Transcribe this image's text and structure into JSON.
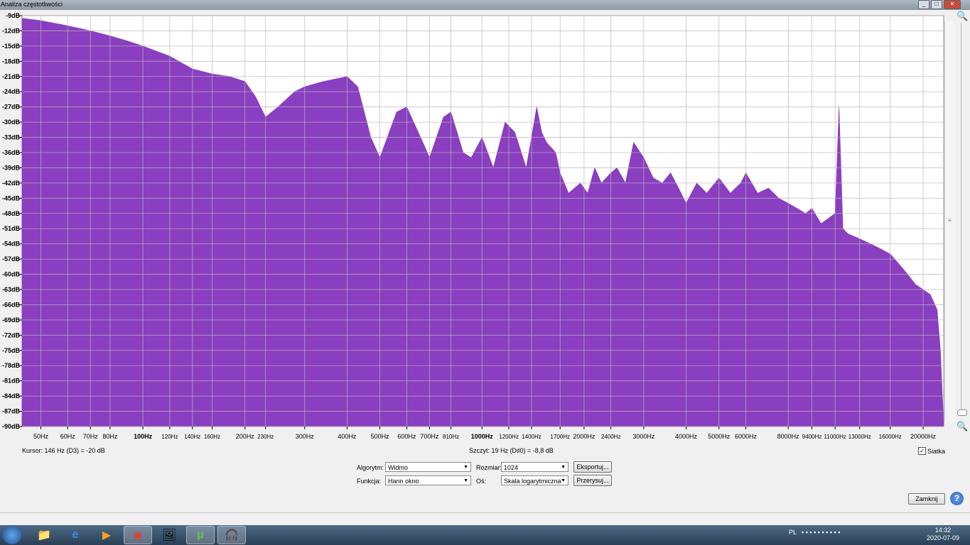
{
  "window": {
    "title": "Analiza częstotliwości",
    "controls": [
      "minimize-icon",
      "maximize-icon",
      "close-icon"
    ]
  },
  "chart_data": {
    "type": "area",
    "xscale": "log",
    "xlim": [
      44,
      23000
    ],
    "ylim": [
      -90,
      -9
    ],
    "grid": true,
    "fill_color": "#8a3ec0",
    "y_ticks": [
      -9,
      -12,
      -15,
      -18,
      -21,
      -24,
      -27,
      -30,
      -33,
      -36,
      -39,
      -42,
      -45,
      -48,
      -51,
      -54,
      -57,
      -60,
      -63,
      -66,
      -69,
      -72,
      -75,
      -78,
      -81,
      -84,
      -87,
      -90
    ],
    "y_tick_labels": [
      "-9dB",
      "-12dB",
      "-15dB",
      "-18dB",
      "-21dB",
      "-24dB",
      "-27dB",
      "-30dB",
      "-33dB",
      "-36dB",
      "-39dB",
      "-42dB",
      "-45dB",
      "-48dB",
      "-51dB",
      "-54dB",
      "-57dB",
      "-60dB",
      "-63dB",
      "-66dB",
      "-69dB",
      "-72dB",
      "-75dB",
      "-78dB",
      "-81dB",
      "-84dB",
      "-87dB",
      "-90dB"
    ],
    "x_ticks": [
      50,
      60,
      70,
      80,
      100,
      120,
      140,
      160,
      200,
      230,
      300,
      400,
      500,
      600,
      700,
      810,
      1000,
      1200,
      1400,
      1700,
      2000,
      2400,
      3000,
      4000,
      5000,
      6000,
      8000,
      9400,
      11000,
      13000,
      16000,
      20000
    ],
    "x_tick_labels": [
      "50Hz",
      "60Hz",
      "70Hz",
      "80Hz",
      "100Hz",
      "120Hz",
      "140Hz",
      "160Hz",
      "200Hz",
      "230Hz",
      "300Hz",
      "400Hz",
      "500Hz",
      "600Hz",
      "700Hz",
      "810Hz",
      "1000Hz",
      "1200Hz",
      "1400Hz",
      "1700Hz",
      "2000Hz",
      "2400Hz",
      "3000Hz",
      "4000Hz",
      "5000Hz",
      "6000Hz",
      "8000Hz",
      "9400Hz",
      "11000Hz",
      "13000Hz",
      "16000Hz",
      "20000Hz"
    ],
    "x_tick_bold": [
      100,
      1000
    ],
    "x_tick_small": [
      120,
      140,
      160,
      230,
      810,
      1200,
      1400,
      1700,
      2400,
      9400,
      11000,
      13000,
      16000
    ],
    "x": [
      44,
      50,
      60,
      70,
      80,
      90,
      100,
      120,
      140,
      160,
      180,
      200,
      215,
      230,
      250,
      280,
      300,
      340,
      400,
      430,
      470,
      500,
      560,
      600,
      680,
      700,
      770,
      810,
      880,
      930,
      1000,
      1080,
      1170,
      1250,
      1350,
      1450,
      1500,
      1550,
      1650,
      1700,
      1800,
      1950,
      2050,
      2150,
      2250,
      2400,
      2500,
      2650,
      2800,
      3000,
      3200,
      3400,
      3600,
      3800,
      4000,
      4300,
      4600,
      5000,
      5400,
      5800,
      6000,
      6500,
      7000,
      7500,
      8000,
      8500,
      9000,
      9400,
      10000,
      10500,
      11000,
      11300,
      11600,
      12000,
      13000,
      14000,
      15000,
      16000,
      17000,
      18000,
      19000,
      20000,
      21000,
      22000,
      22500,
      23000
    ],
    "y": [
      -9.5,
      -10,
      -11,
      -12,
      -13,
      -14,
      -15,
      -17,
      -19.5,
      -20.5,
      -21,
      -22,
      -25,
      -29,
      -27,
      -24,
      -23,
      -22,
      -21,
      -23,
      -33,
      -37,
      -28,
      -27,
      -35,
      -37,
      -29,
      -28,
      -36,
      -37,
      -33,
      -39,
      -30,
      -32,
      -39,
      -27,
      -32,
      -34,
      -36,
      -40,
      -44,
      -42,
      -44,
      -39,
      -42,
      -40,
      -39,
      -42,
      -34,
      -37,
      -41,
      -42,
      -40,
      -43,
      -46,
      -42,
      -44,
      -41,
      -44,
      -42,
      -40,
      -44,
      -43,
      -45,
      -46,
      -47,
      -48,
      -47,
      -50,
      -49,
      -48,
      -27,
      -51,
      -52,
      -53,
      -54,
      -55,
      -56,
      -58,
      -60,
      -62,
      -63,
      -64,
      -67,
      -75,
      -90
    ]
  },
  "cursor_text": "Kursor:  146 Hz (D3) = -20 dB",
  "peak_text": "Szczyt:  19 Hz (D♯0) = -8,8 dB",
  "grid_checkbox": {
    "label": "Siatka",
    "checked": true
  },
  "controls": {
    "algorithm_label": "Algorytm:",
    "algorithm_value": "Widmo",
    "size_label": "Rozmiar:",
    "size_value": "1024",
    "export_button": "Eksportuj...",
    "function_label": "Funkcja:",
    "function_value": "Hann okno",
    "axis_label": "Oś:",
    "axis_value": "Skala logarytmiczna",
    "replot_button": "Przerysuj...",
    "close_button": "Zamknij",
    "help_button": "?"
  },
  "taskbar": {
    "apps": [
      "explorer-icon",
      "internet-explorer-icon",
      "media-player-icon",
      "chrome-icon",
      "photo-viewer-icon",
      "utorrent-icon",
      "audacity-icon"
    ],
    "language": "PL",
    "time": "14:32",
    "date": "2020-07-09"
  }
}
